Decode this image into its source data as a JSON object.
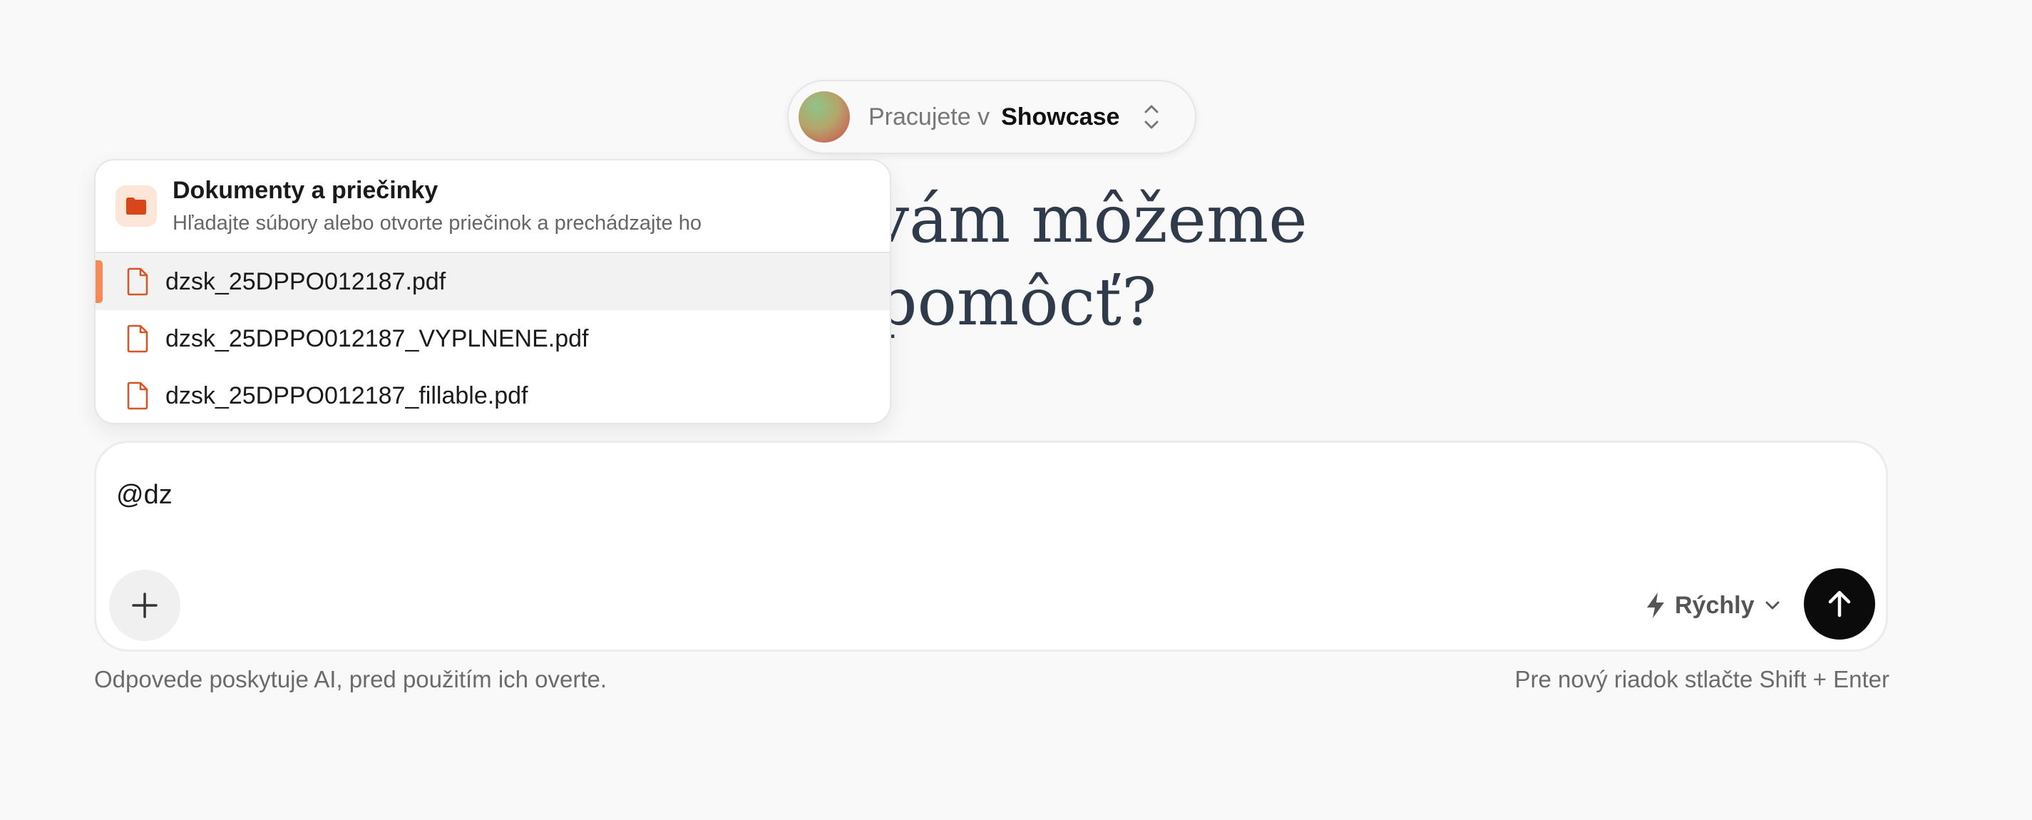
{
  "workspace": {
    "prefix": "Pracujete v",
    "name": "Showcase"
  },
  "heading": {
    "line1": "Ako vám môžeme",
    "line2": "pomôcť?"
  },
  "dropdown": {
    "title": "Dokumenty a priečinky",
    "subtitle": "Hľadajte súbory alebo otvorte priečinok a prechádzajte ho",
    "items": [
      {
        "label": "dzsk_25DPPO012187.pdf",
        "active": true
      },
      {
        "label": "dzsk_25DPPO012187_VYPLNENE.pdf",
        "active": false
      },
      {
        "label": "dzsk_25DPPO012187_fillable.pdf",
        "active": false
      }
    ]
  },
  "composer": {
    "value": "@dz",
    "mode_label": "Rýchly"
  },
  "footer": {
    "disclaimer": "Odpovede poskytuje AI, pred použitím ich overte.",
    "hint": "Pre nový riadok stlačte Shift + Enter"
  },
  "colors": {
    "accent": "#f28b55",
    "file_icon": "#d4572a",
    "folder": "#d8471a",
    "send_button": "#0b0b0b"
  },
  "icons": {
    "workspace_switch": "chevron-up-down-icon",
    "folder": "folder-icon",
    "file": "file-icon",
    "add": "plus-icon",
    "mode": "lightning-icon",
    "mode_dropdown": "chevron-down-icon",
    "send": "arrow-up-icon"
  }
}
